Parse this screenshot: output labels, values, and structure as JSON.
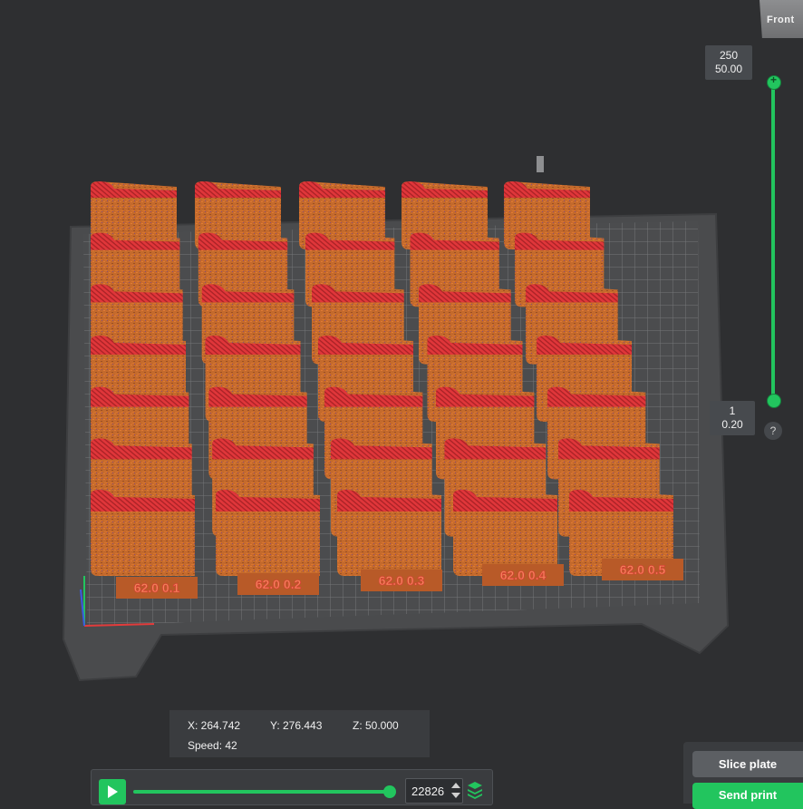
{
  "view_cube": {
    "label": "Front"
  },
  "layer_slider": {
    "top": {
      "layer": "250",
      "height": "50.00"
    },
    "bottom": {
      "layer": "1",
      "height": "0.20"
    },
    "help": "?"
  },
  "plate": {
    "object_labels": [
      "62.0 0.1",
      "62.0 0.2",
      "62.0 0.3",
      "62.0 0.4",
      "62.0 0.5"
    ],
    "colors": {
      "wall": "#c46a2c",
      "top": "#e0363a",
      "plate": "#4b4c4e",
      "grid": "#7a7b7d",
      "accent": "#22c55e"
    }
  },
  "coords": {
    "x": "X: 264.742",
    "y": "Y: 276.443",
    "z": "Z: 50.000",
    "speed": "Speed: 42"
  },
  "playback": {
    "progress_fraction": 1.0,
    "move_value": "22826"
  },
  "actions": {
    "slice_label": "Slice plate",
    "send_label": "Send print"
  }
}
